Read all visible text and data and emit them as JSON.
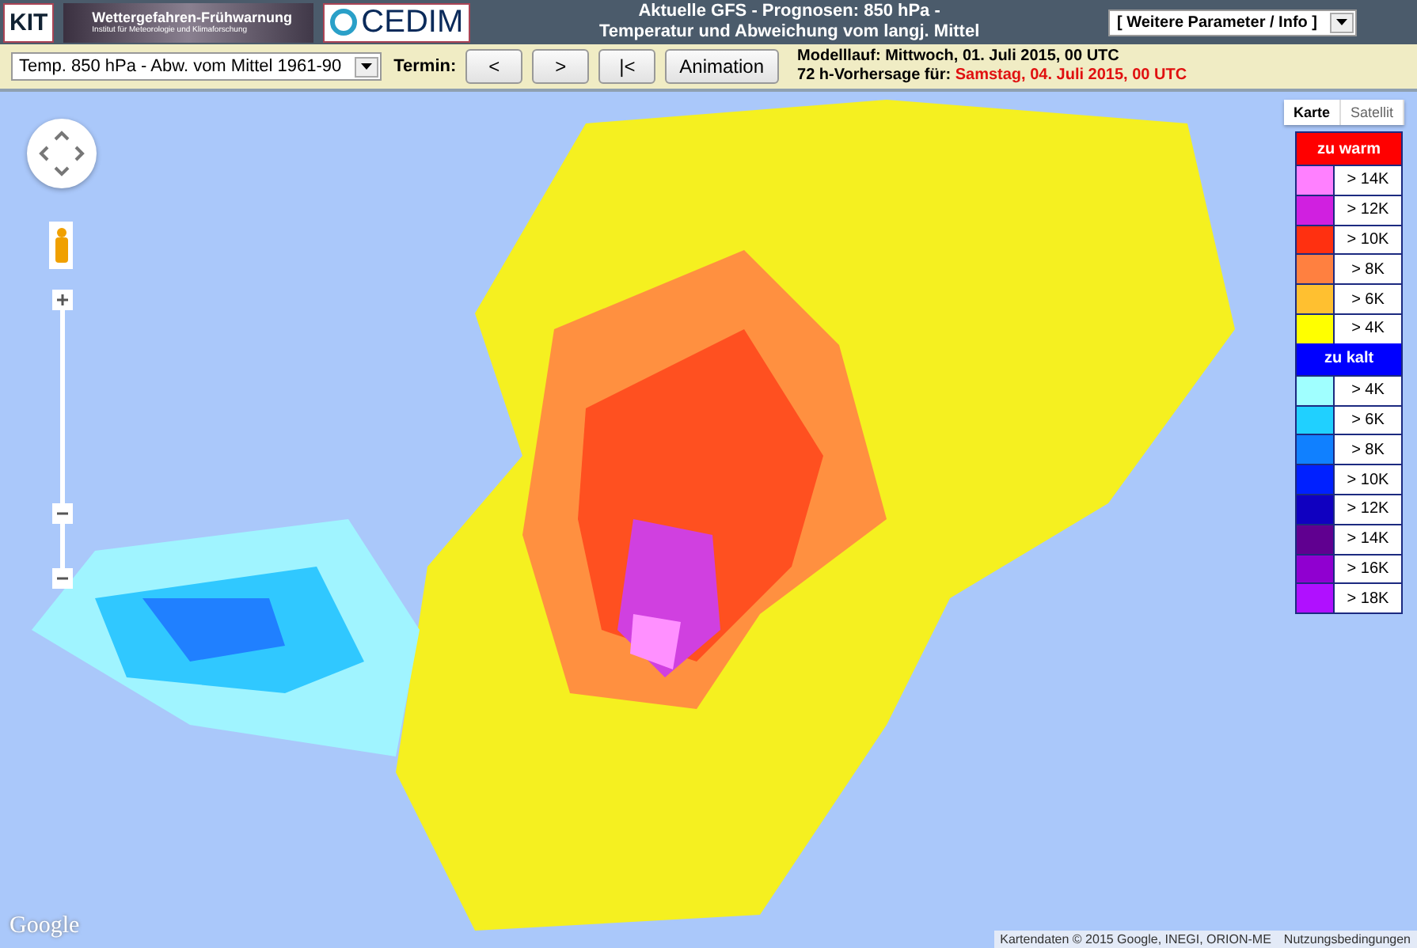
{
  "header": {
    "logos": {
      "kit": "KIT",
      "banner_title": "Wettergefahren-Frühwarnung",
      "banner_subtitle": "Institut für Meteorologie und Klimaforschung",
      "cedim": "CEDIM"
    },
    "title_lines": [
      "Aktuelle GFS - Prognosen: 850 hPa -",
      "Temperatur und Abweichung vom langj. Mittel"
    ],
    "info_select": "[ Weitere Parameter / Info ]"
  },
  "toolbar": {
    "parameter_select": "Temp. 850 hPa - Abw. vom Mittel 1961-90",
    "termin_label": "Termin:",
    "buttons": [
      "<",
      ">",
      "|<",
      "Animation"
    ],
    "model_run": "Modelllauf: Mittwoch, 01. Juli 2015, 00 UTC",
    "forecast_label": "72 h-Vorhersage für:",
    "forecast_time": "Samstag, 04. Juli 2015, 00 UTC"
  },
  "map": {
    "map_types": [
      {
        "label": "Karte",
        "selected": true
      },
      {
        "label": "Satellit",
        "selected": false
      }
    ],
    "legend": [
      {
        "kind": "heading",
        "label": "zu warm",
        "color": "#ff0000"
      },
      {
        "kind": "entry",
        "label": "> 14K",
        "color": "#ff80ff"
      },
      {
        "kind": "entry",
        "label": "> 12K",
        "color": "#d020e0"
      },
      {
        "kind": "entry",
        "label": "> 10K",
        "color": "#ff3010"
      },
      {
        "kind": "entry",
        "label": "> 8K",
        "color": "#ff8040"
      },
      {
        "kind": "entry",
        "label": "> 6K",
        "color": "#ffc030"
      },
      {
        "kind": "entry",
        "label": "> 4K",
        "color": "#ffff00"
      },
      {
        "kind": "heading",
        "label": "zu kalt",
        "color": "#0000ff"
      },
      {
        "kind": "entry",
        "label": "> 4K",
        "color": "#a0ffff"
      },
      {
        "kind": "entry",
        "label": "> 6K",
        "color": "#20d0ff"
      },
      {
        "kind": "entry",
        "label": "> 8K",
        "color": "#1080ff"
      },
      {
        "kind": "entry",
        "label": "> 10K",
        "color": "#0020ff"
      },
      {
        "kind": "entry",
        "label": "> 12K",
        "color": "#1000c0"
      },
      {
        "kind": "entry",
        "label": "> 14K",
        "color": "#600090"
      },
      {
        "kind": "entry",
        "label": "> 16K",
        "color": "#9000d0"
      },
      {
        "kind": "entry",
        "label": "> 18K",
        "color": "#b010ff"
      }
    ],
    "google": "Google",
    "attribution": "Kartendaten © 2015 Google, INEGI, ORION-ME",
    "terms": "Nutzungsbedingungen"
  }
}
